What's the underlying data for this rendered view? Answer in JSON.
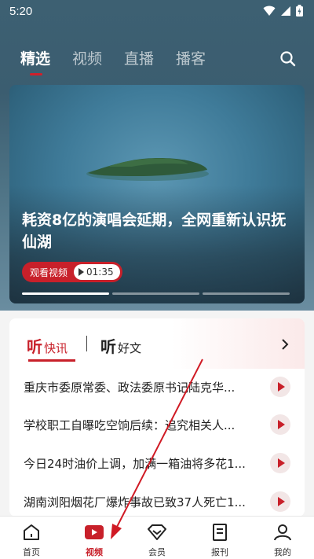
{
  "status_bar": {
    "time": "5:20"
  },
  "top_tabs": [
    {
      "label": "精选",
      "active": true
    },
    {
      "label": "视频",
      "active": false
    },
    {
      "label": "直播",
      "active": false
    },
    {
      "label": "播客",
      "active": false
    }
  ],
  "hero": {
    "title": "耗资8亿的演唱会延期，全网重新认识抚仙湖",
    "watch_label": "观看视频",
    "duration": "01:35"
  },
  "listen_panel": {
    "tab_news": {
      "big": "听",
      "small": "快讯"
    },
    "tab_articles": {
      "big": "听",
      "small": "好文"
    },
    "items": [
      "重庆市委原常委、政法委原书记陆克华...",
      "学校职工自曝吃空饷后续：追究相关人...",
      "今日24时油价上调，加满一箱油将多花1...",
      "湖南浏阳烟花厂爆炸事故已致37人死亡1..."
    ]
  },
  "bottom_nav": [
    {
      "label": "首页",
      "icon": "home-icon"
    },
    {
      "label": "视频",
      "icon": "video-icon"
    },
    {
      "label": "会员",
      "icon": "member-icon"
    },
    {
      "label": "报刊",
      "icon": "newspaper-icon"
    },
    {
      "label": "我的",
      "icon": "profile-icon"
    }
  ],
  "colors": {
    "accent": "#c8202a",
    "hero_bg": "#3d6072"
  }
}
